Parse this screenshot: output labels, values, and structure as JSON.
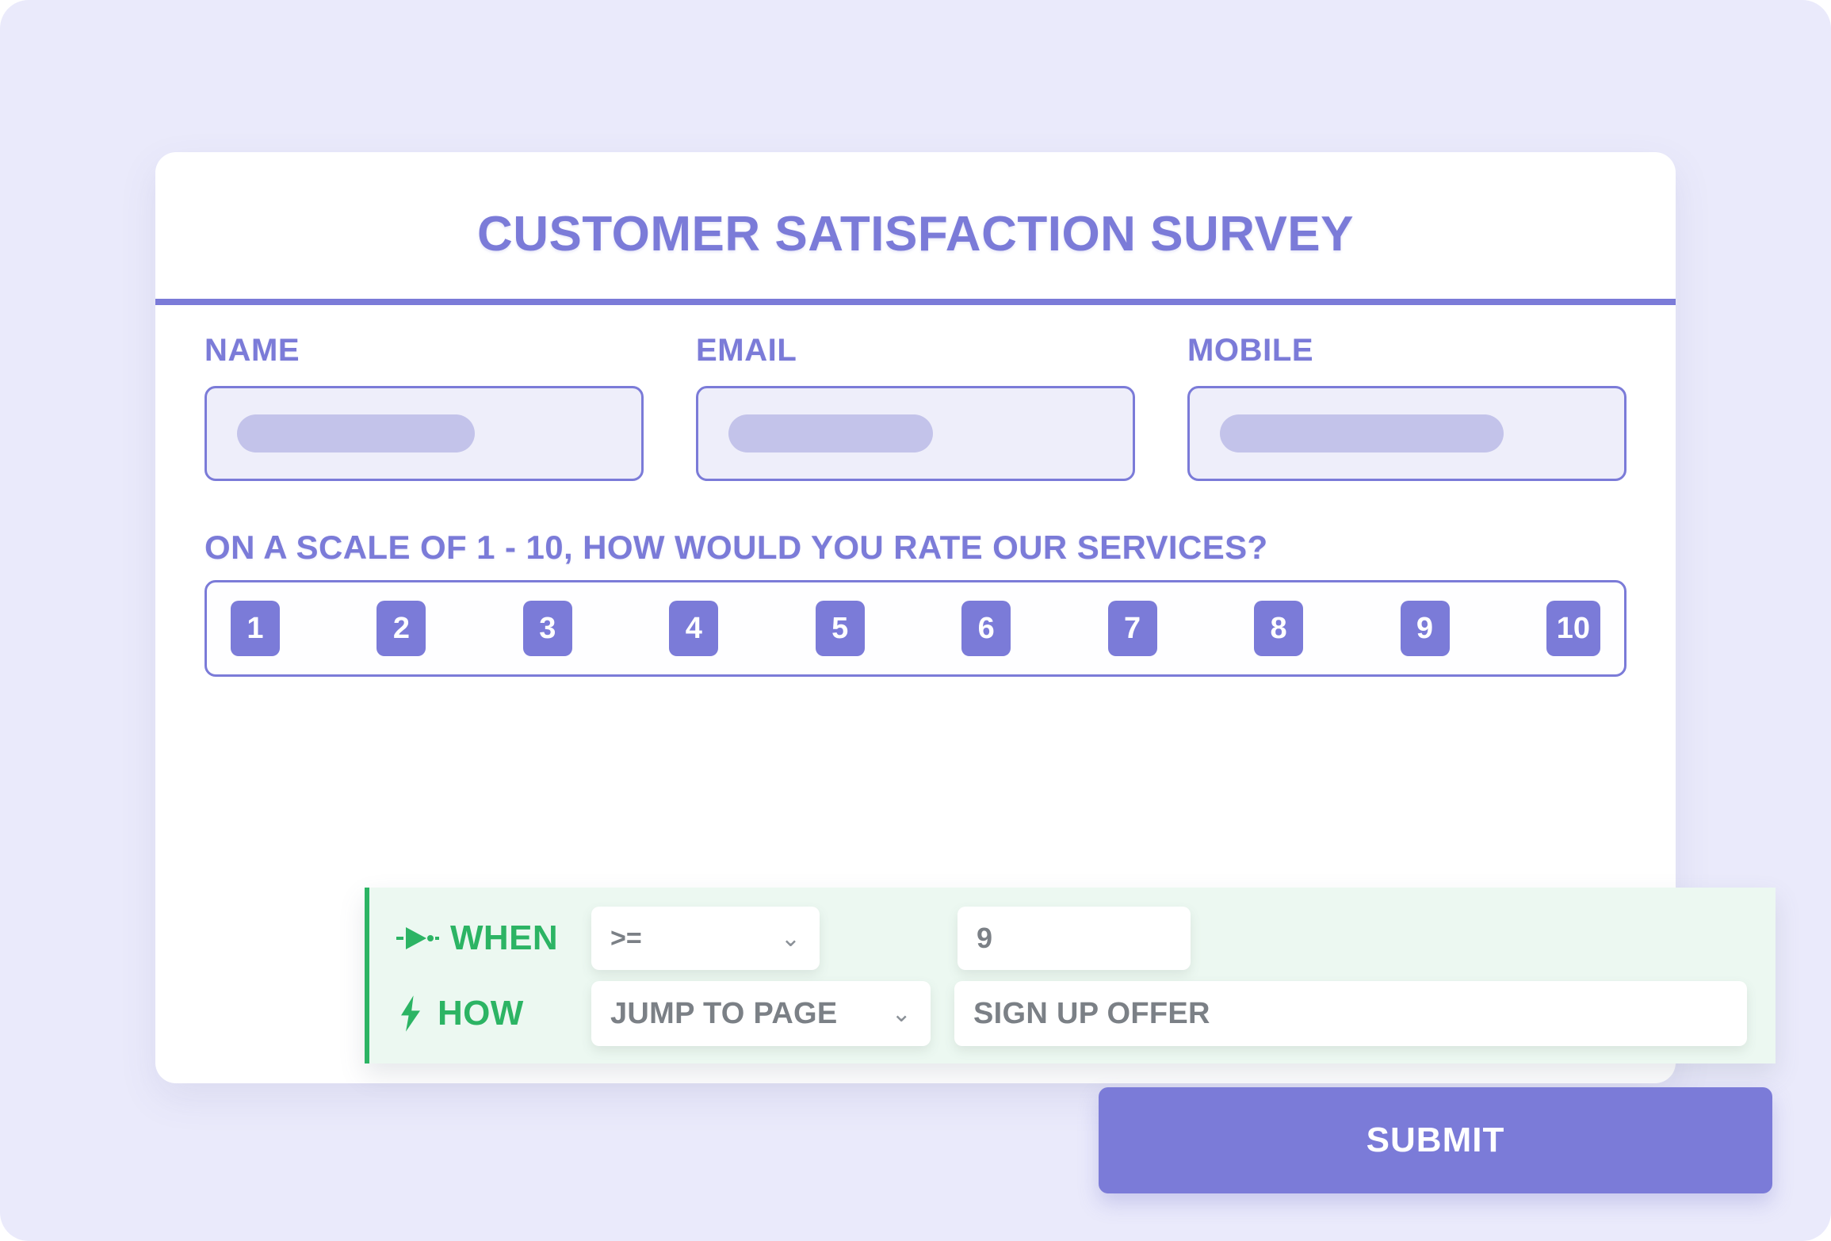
{
  "card": {
    "title": "CUSTOMER SATISFACTION SURVEY"
  },
  "fields": [
    {
      "label": "NAME",
      "value": "",
      "placeholder": ""
    },
    {
      "label": "EMAIL",
      "value": "",
      "placeholder": ""
    },
    {
      "label": "MOBILE",
      "value": "",
      "placeholder": ""
    }
  ],
  "rating": {
    "question": "ON A SCALE OF 1 - 10, HOW WOULD YOU RATE OUR SERVICES?",
    "options": [
      "1",
      "2",
      "3",
      "4",
      "5",
      "6",
      "7",
      "8",
      "9",
      "10"
    ]
  },
  "logic": {
    "when": {
      "label": "WHEN",
      "icon": "play-node-icon",
      "operator": ">=",
      "operator_chevron": "⌄",
      "value": "9"
    },
    "how": {
      "label": "HOW",
      "icon": "lightning-bolt-icon",
      "action": "JUMP TO PAGE",
      "action_chevron": "⌄",
      "target": "SIGN UP OFFER"
    }
  },
  "submit": {
    "label": "SUBMIT"
  },
  "colors": {
    "accent_purple": "#7b7bd8",
    "accent_green": "#2cb464",
    "page_background": "#eaeafb",
    "card_background": "#ffffff",
    "field_fill": "#eeeefa",
    "placeholder_pill": "#c3c3ea",
    "logic_panel_background": "#ecf8f1",
    "control_text": "#7b8086"
  }
}
